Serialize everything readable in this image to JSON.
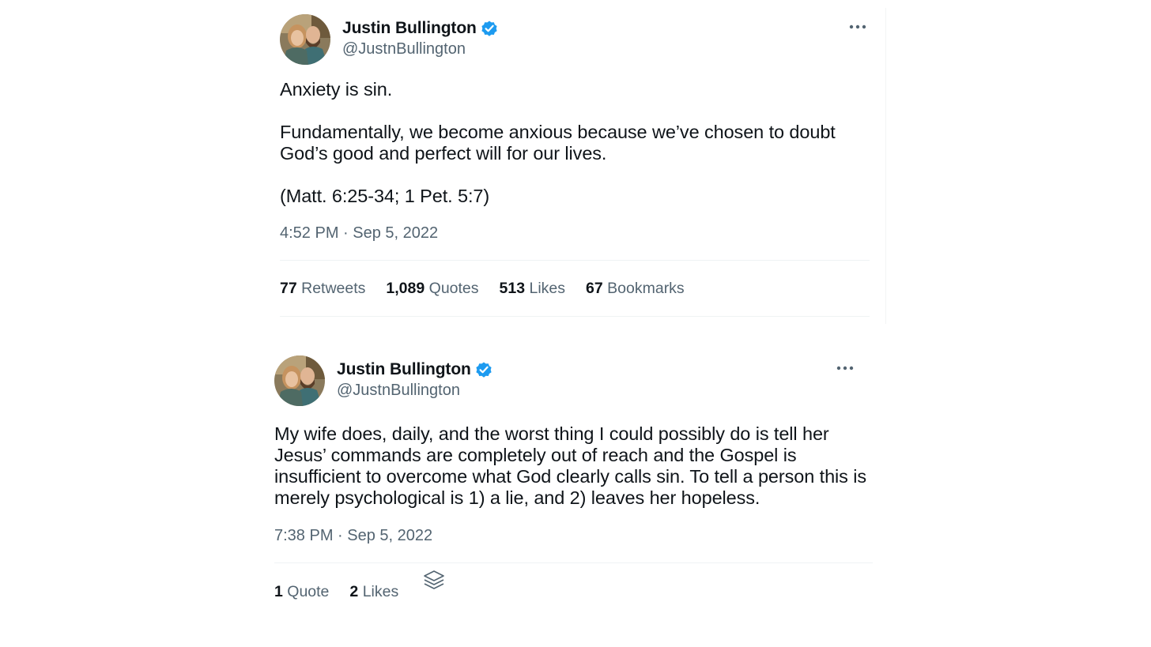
{
  "tweets": [
    {
      "author": {
        "display_name": "Justin Bullington",
        "handle": "@JustnBullington",
        "verified": true
      },
      "text": "Anxiety is sin.\n\nFundamentally, we become anxious because we’ve chosen to doubt God’s good and perfect will for our lives.\n\n(Matt. 6:25-34; 1 Pet. 5:7)",
      "timestamp": "4:52 PM · Sep 5, 2022",
      "stats": [
        {
          "count": "77",
          "label": "Retweets"
        },
        {
          "count": "1,089",
          "label": "Quotes"
        },
        {
          "count": "513",
          "label": "Likes"
        },
        {
          "count": "67",
          "label": "Bookmarks"
        }
      ]
    },
    {
      "author": {
        "display_name": "Justin Bullington",
        "handle": "@JustnBullington",
        "verified": true
      },
      "text": "My wife does, daily, and the worst thing I could possibly do is tell her Jesus’ commands are completely out of reach and the Gospel is insufficient to overcome what God clearly calls sin. To tell a person this is merely psychological is 1) a lie, and 2) leaves her hopeless.",
      "timestamp": "7:38 PM · Sep 5, 2022",
      "stats": [
        {
          "count": "1",
          "label": "Quote"
        },
        {
          "count": "2",
          "label": "Likes"
        }
      ]
    }
  ],
  "icons": {
    "verified": "verified-badge-icon",
    "more": "more-options-icon",
    "layers": "layers-icon"
  },
  "colors": {
    "text_primary": "#0f1419",
    "text_secondary": "#536471",
    "verified_blue": "#1d9bf0",
    "divider": "#eff3f4"
  }
}
